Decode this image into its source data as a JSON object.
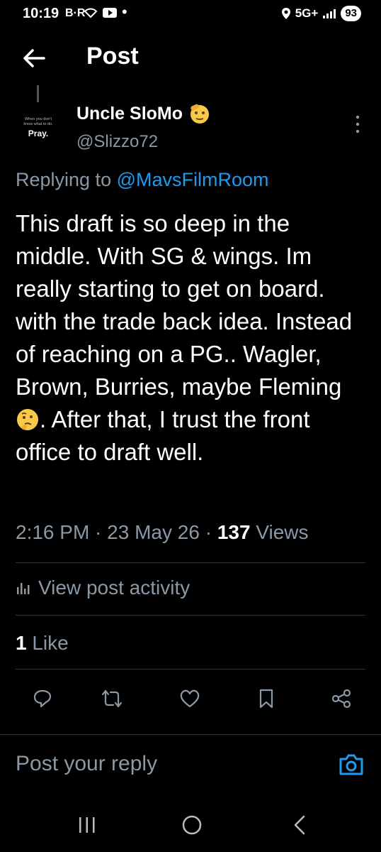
{
  "status_bar": {
    "time": "10:19",
    "app_badge": "B·R",
    "network": "5G+",
    "battery": "93"
  },
  "header": {
    "title": "Post"
  },
  "author": {
    "display_name": "Uncle SloMo",
    "handle": "@Slizzo72",
    "avatar_caption": "When you don't know what to do.",
    "avatar_word": "Pray."
  },
  "post": {
    "replying_prefix": "Replying to ",
    "replying_to": "@MavsFilmRoom",
    "text_part1": "This draft is so deep in the middle. With SG & wings. Im really starting to get on board. with the trade back idea. Instead of reaching on a PG.. Wagler, Brown, Burries, maybe Fleming ",
    "text_part2": ". After that, I trust the front office to draft well.",
    "time": "2:16 PM",
    "date": "23 May 26",
    "views_count": "137",
    "views_label": "Views",
    "separator": " · "
  },
  "activity_label": "View post activity",
  "likes": {
    "count": "1",
    "label": "Like"
  },
  "actions": [
    "reply-icon",
    "repost-icon",
    "like-icon",
    "bookmark-icon",
    "share-icon"
  ],
  "reply_bar": {
    "placeholder": "Post your reply"
  },
  "colors": {
    "accent": "#1d9bf0",
    "muted": "#8b98a5",
    "background": "#000000"
  }
}
